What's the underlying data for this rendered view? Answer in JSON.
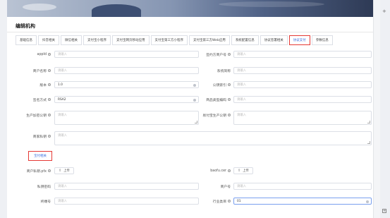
{
  "panel": {
    "title": "编辑机构"
  },
  "tabs": [
    {
      "label": "基础信息"
    },
    {
      "label": "抖音相关"
    },
    {
      "label": "微信相关"
    },
    {
      "label": "支付宝小程序"
    },
    {
      "label": "支付宝网页移动应用"
    },
    {
      "label": "支付宝第三方小程序"
    },
    {
      "label": "支付宝第三方Web应用"
    },
    {
      "label": "系统配置信息"
    },
    {
      "label": "协议签署相关"
    },
    {
      "label": "协议支付"
    },
    {
      "label": "参数信息"
    }
  ],
  "active_tab": "协议支付",
  "form": {
    "appid": {
      "label": "appId",
      "placeholder": "请输入"
    },
    "merchant_no": {
      "label": "签约方商户号",
      "placeholder": "请输入"
    },
    "merchant_name": {
      "label": "商户名称",
      "placeholder": "请输入"
    },
    "system_short": {
      "label": "系统简称",
      "placeholder": "请输入"
    },
    "version": {
      "label": "版本",
      "value": "1.0"
    },
    "pubkey_index": {
      "label": "公钥索引",
      "placeholder": "请输入"
    },
    "sign_method": {
      "label": "签名方式",
      "value": "RSA2"
    },
    "product_code": {
      "label": "商品类型编码",
      "placeholder": "请输入"
    },
    "prod_pubkey": {
      "label": "生产加密公钥",
      "placeholder": "请输入"
    },
    "pay_pubkey": {
      "label": "易付宝生产公钥",
      "placeholder": "请输入"
    },
    "merchant_privkey": {
      "label": "商家私钥",
      "placeholder": "请输入"
    }
  },
  "section": {
    "label": "宝付相关"
  },
  "baofu": {
    "pfx": {
      "label": "商户私钥.pfx",
      "button": "上传"
    },
    "cer": {
      "label": "baofu.cer",
      "button": "上传"
    },
    "private_pwd": {
      "label": "私钥密码",
      "placeholder": "请输入"
    },
    "merchant_id": {
      "label": "商户号",
      "placeholder": "请输入"
    },
    "terminal_id": {
      "label": "终端号",
      "placeholder": "请输入"
    },
    "industry": {
      "label": "行业类目",
      "value": "01"
    }
  },
  "icons": {
    "help": "question-circle-icon",
    "upload": "upload-icon",
    "clear": "clear-icon"
  }
}
